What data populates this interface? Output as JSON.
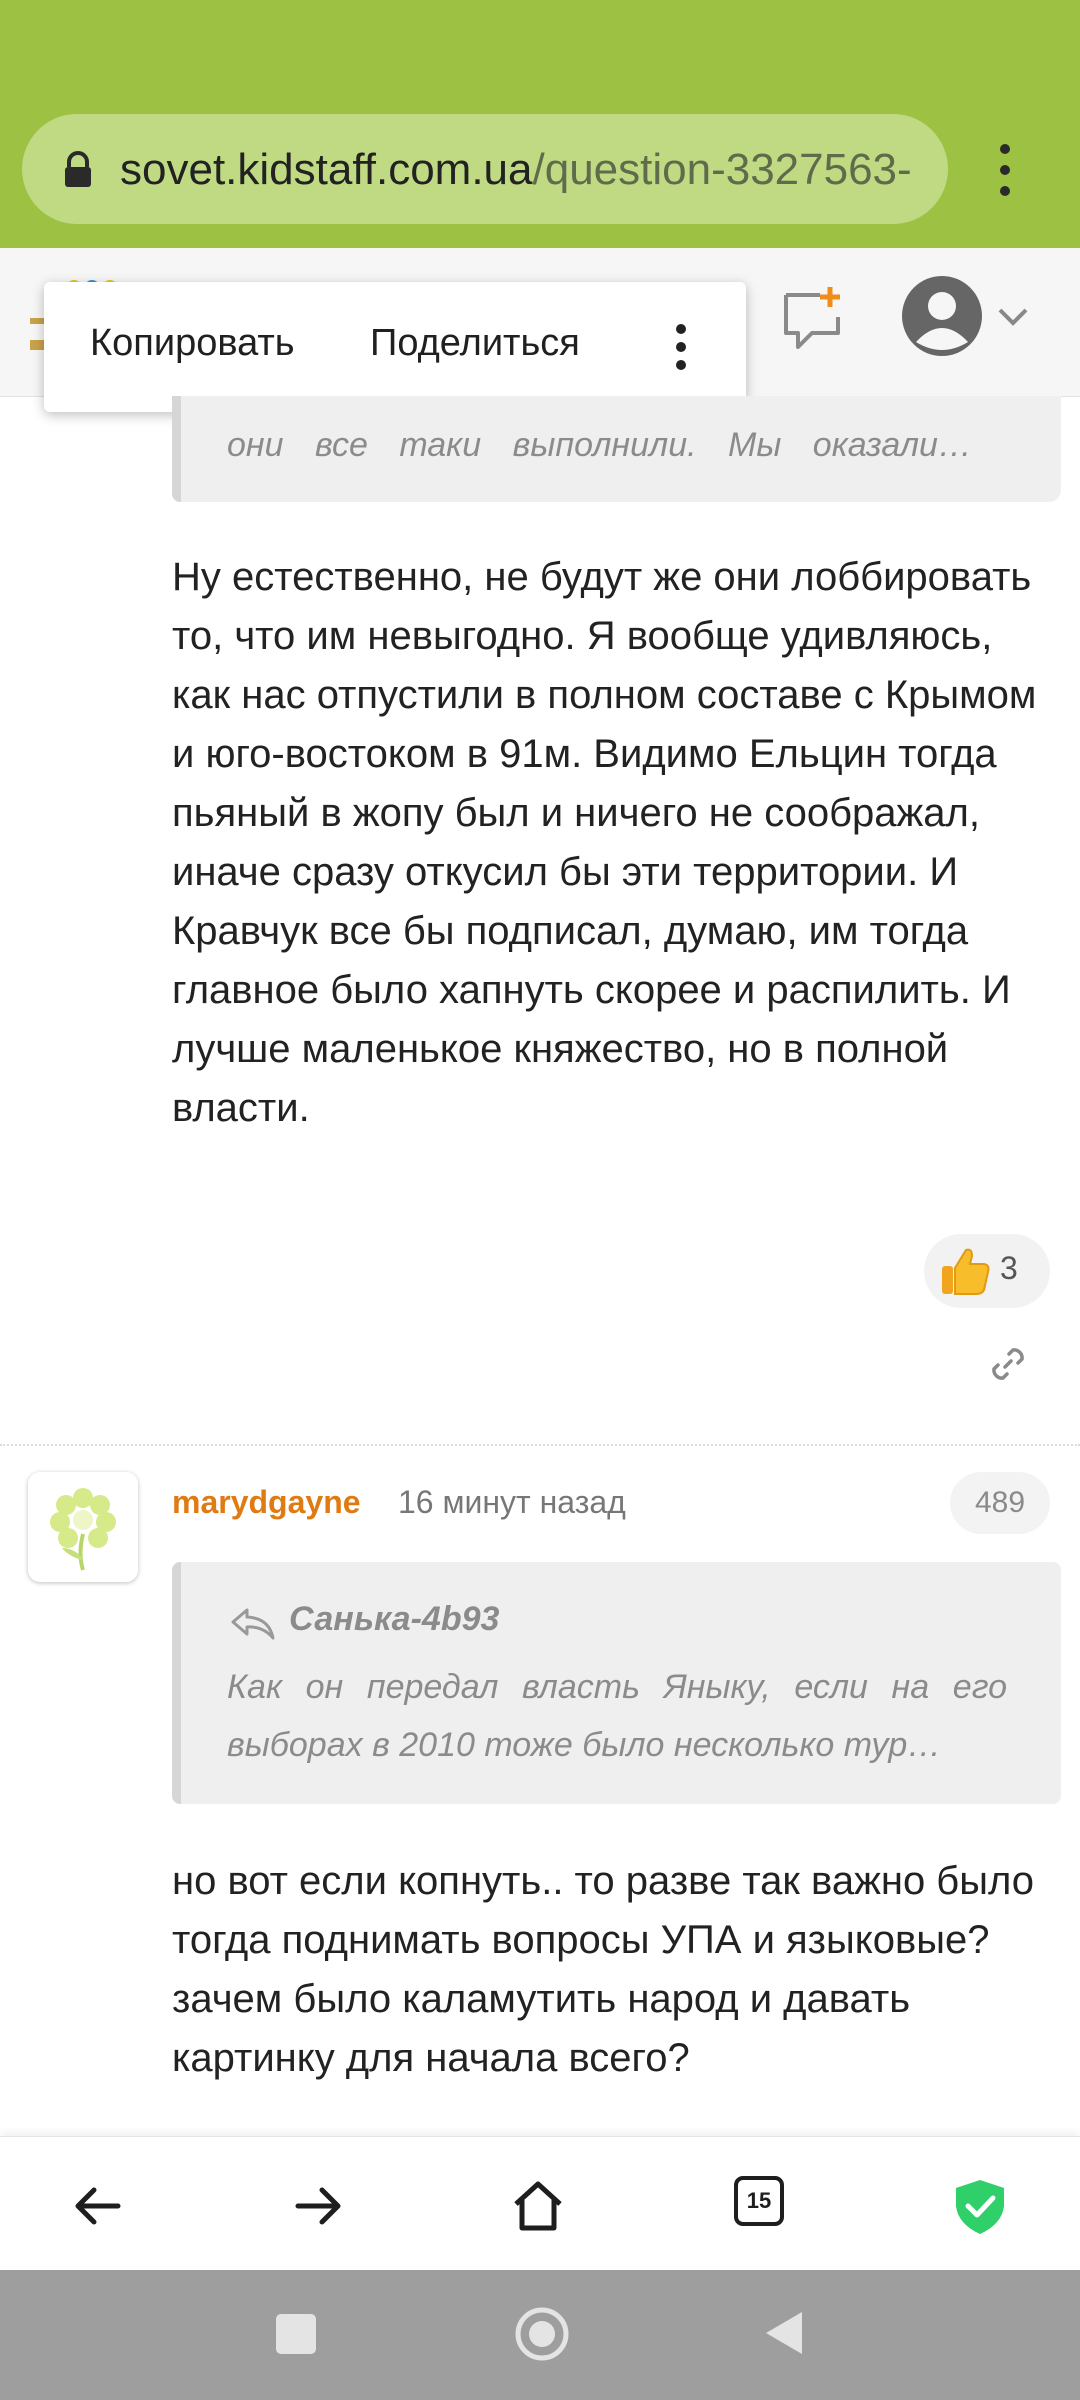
{
  "browser": {
    "url_host": "sovet.kidstaff.com.ua",
    "url_path": "/question-3327563-"
  },
  "context_menu": {
    "copy": "Копировать",
    "share": "Поделиться"
  },
  "quote1": {
    "text": "они все таки выполнили. Мы оказали…"
  },
  "comment1": {
    "text": "Ну естественно, не будут же они лоббировать то, что им невыгодно. Я вообще удивляюсь, как нас отпустили в полном составе с Крымом и юго-востоком в 91м. Видимо Ельцин тогда пьяный в жопу был и ничего не соображал, иначе сразу откусил бы эти территории. И Кравчук все бы подписал, думаю, им тогда главное было хапнуть скорее и распилить. И лучше маленькое княжество, но в полной власти.",
    "likes": "3"
  },
  "post2": {
    "username": "marydgayne",
    "time": "16 минут назад",
    "number": "489",
    "quote_author": "Санька-4b93",
    "quote_text": "Как он передал власть Яныку, если на его выборах в 2010 тоже было несколько тур…",
    "text": "но вот если копнуть.. то разве так важно было тогда поднимать вопросы УПА и языковые? зачем было каламутить народ и давать картинку для начала всего?"
  },
  "bottom_bar": {
    "tabs_count": "15"
  },
  "colors": {
    "browser_green": "#9dc143",
    "username_orange": "#e07a13",
    "shield_green": "#2fcf6a"
  },
  "icons": [
    "lock-icon",
    "more-vert-icon",
    "new-chat-icon",
    "avatar-icon",
    "chevron-down-icon",
    "thumbs-up-icon",
    "link-icon",
    "reply-icon",
    "back-arrow-icon",
    "forward-arrow-icon",
    "home-icon",
    "tabs-icon",
    "shield-icon"
  ]
}
